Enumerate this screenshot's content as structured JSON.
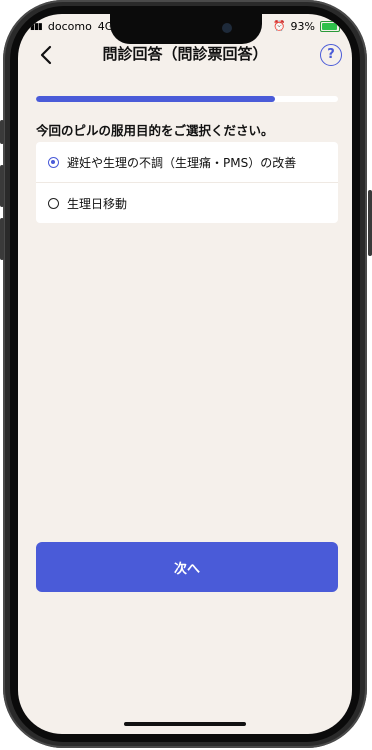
{
  "status_bar": {
    "carrier": "docomo",
    "network": "4G",
    "battery_percent": "93%"
  },
  "header": {
    "title": "問診回答（問診票回答）",
    "help_label": "?"
  },
  "progress": {
    "fraction": 0.79
  },
  "question": {
    "text": "今回のピルの服用目的をご選択ください。"
  },
  "options": [
    {
      "label": "避妊や生理の不調（生理痛・PMS）の改善",
      "selected": true
    },
    {
      "label": "生理日移動",
      "selected": false
    }
  ],
  "next_button": {
    "label": "次へ"
  },
  "colors": {
    "accent": "#4a5bd8",
    "background": "#f5f0eb"
  }
}
